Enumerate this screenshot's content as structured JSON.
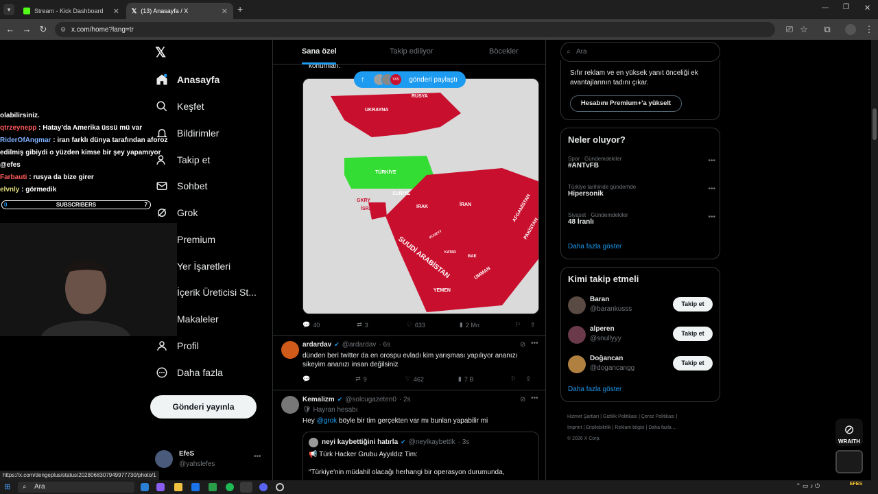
{
  "browser": {
    "tabs": [
      {
        "label": "Stream - Kick Dashboard"
      },
      {
        "label": "(13) Anasayfa / X"
      }
    ],
    "url": "x.com/home?lang=tr",
    "status_url": "https://x.com/dengeplus/status/2028068307949977730/photo/1"
  },
  "overlay": {
    "chat": [
      {
        "user": "",
        "text": "olabilirsiniz."
      },
      {
        "user": "qtrzeynepp",
        "text": ": Hatay'da Amerika üssü mü var"
      },
      {
        "user": "RiderOfAngmar",
        "text": ": iran farklı dünya tarafından aforoz edilmiş gibiydi o yüzden kimse bir şey yapamıyor @efes"
      },
      {
        "user": "Farbauti",
        "text": ": rusya da bize girer"
      },
      {
        "user": "elvnly",
        "text": ": görmedik"
      }
    ],
    "subs": {
      "label": "SUBSCRIBERS",
      "current": "0",
      "goal": "7"
    },
    "brand": "WRAITH",
    "streamer": "EFES"
  },
  "nav": {
    "items": [
      {
        "label": "Anasayfa"
      },
      {
        "label": "Keşfet"
      },
      {
        "label": "Bildirimler"
      },
      {
        "label": "Takip et"
      },
      {
        "label": "Sohbet"
      },
      {
        "label": "Grok"
      },
      {
        "label": "Premium"
      },
      {
        "label": "Yer İşaretleri"
      },
      {
        "label": "İçerik Üreticisi St..."
      },
      {
        "label": "Makaleler"
      },
      {
        "label": "Profil"
      },
      {
        "label": "Daha fazla"
      }
    ],
    "post_button": "Gönderi yayınla",
    "account": {
      "name": "EfeS",
      "handle": "@yahslefes"
    }
  },
  "feed": {
    "tabs": [
      "Sana özel",
      "Takip ediliyor",
      "Böcekler"
    ],
    "toast": "gönderi paylaştı",
    "toast_badge": "YAS",
    "top_text": "konumları.",
    "map_labels": [
      "RUSYA",
      "UKRAYNA",
      "TÜRKİYE",
      "GKRY",
      "İSRAİL",
      "SURİYE",
      "IRAK",
      "İRAN",
      "AFGANİSTAN",
      "PAKİSTAN",
      "SUUDİ ARABİSTAN",
      "KUVEYT",
      "KATAR",
      "BAE",
      "UMMAN",
      "YEMEN"
    ],
    "first_actions": {
      "replies": "40",
      "reposts": "3",
      "likes": "633",
      "views": "2 Mn"
    },
    "tweets": [
      {
        "name": "ardardav",
        "handle": "@ardardav",
        "time": "· 6s",
        "text": "dünden beri twitter da en orospu evladı kim yarışması yapılıyor ananızı sikeyim ananızı insan değilsiniz",
        "reposts": "9",
        "likes": "462",
        "views": "7 B"
      },
      {
        "name": "Kemalizm",
        "handle": "@solcugazeten0",
        "time": "· 2s",
        "badge": "Hayran hesabı",
        "text_prefix": "Hey ",
        "mention": "@grok",
        "text": " böyle bir tim gerçekten var mı bunlan yapabilir mi",
        "quote": {
          "name": "neyi kaybettiğini hatırla",
          "handle": "@neylkaybettlk",
          "time": "· 3s",
          "line1": "Türk Hacker Grubu Ayyıldız Tim:",
          "line2": "“Türkiye'nin müdahil olacağı herhangi bir operasyon durumunda,"
        }
      }
    ]
  },
  "right": {
    "search_placeholder": "Ara",
    "premium": {
      "text": "Sıfır reklam ve en yüksek yanıt önceliği ek avantajlarının tadını çıkar.",
      "button": "Hesabını Premium+'a yükselt"
    },
    "trends": {
      "title": "Neler oluyor?",
      "items": [
        {
          "cat": "Spor · Gündemdekiler",
          "name": "#ANTvFB"
        },
        {
          "cat": "Türkiye tarihinde gündemde",
          "name": "Hipersonik"
        },
        {
          "cat": "Siyaset · Gündemdekiler",
          "name": "48 İranlı"
        }
      ],
      "more": "Daha fazla göster"
    },
    "who": {
      "title": "Kimi takip etmeli",
      "items": [
        {
          "name": "Baran",
          "handle": "@barankusss",
          "button": "Takip et"
        },
        {
          "name": "alperen",
          "handle": "@snullyyy",
          "button": "Takip et"
        },
        {
          "name": "Doğancan",
          "handle": "@dogancangg",
          "button": "Takip et"
        }
      ],
      "more": "Daha fazla göster"
    },
    "footer": [
      "Hizmet Şartları",
      "Gizlilik Politikası",
      "Çerez Politikası",
      "Imprint",
      "Erişilebilirlik",
      "Reklam bilgisi",
      "Daha fazla ...",
      "© 2026 X Corp."
    ]
  },
  "taskbar": {
    "search": "Ara"
  }
}
